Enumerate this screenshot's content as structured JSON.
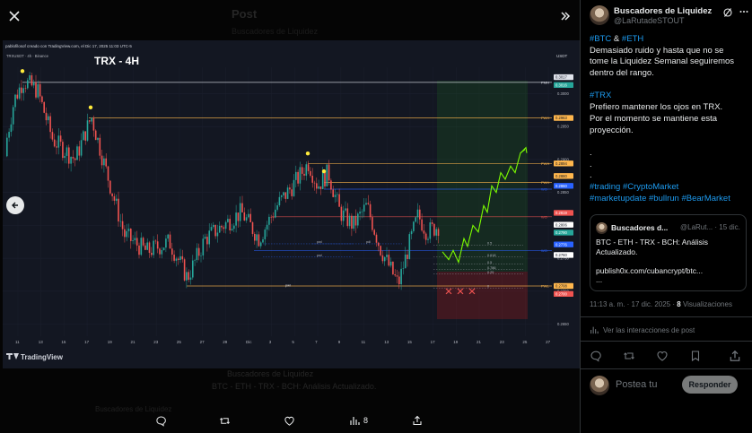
{
  "viewer": {
    "ghost_title": "Post",
    "ghost_author": "Buscadores de Liquidez",
    "ghost_reply_author": "Buscadores de Liquidez",
    "ghost_reply_text": "BTC - ETH - TRX - BCH: Análisis Actualizado.",
    "ghost_quote_author": "Buscadores de Liquidez"
  },
  "tradingview": {
    "header": "pablofilosof creado con TradingView.com, el Dic 17, 2025 11:03 UTC-5",
    "symbol": "TRXUSDT · 4h · Binance",
    "overlay_title": "TRX - 4H",
    "currency": "USDT",
    "logo_text": "TradingView",
    "x_ticks": [
      "11",
      "13",
      "15",
      "17",
      "19",
      "21",
      "23",
      "25",
      "27",
      "29",
      "Dic",
      "3",
      "5",
      "7",
      "9",
      "11",
      "13",
      "15",
      "17",
      "19",
      "21",
      "23",
      "25",
      "27"
    ],
    "y_ticks": [
      "0.3000",
      "0.2950",
      "0.2900",
      "0.2850",
      "0.2800",
      "0.2750",
      "0.2700",
      "0.2650"
    ],
    "levels": [
      {
        "label": "PMH",
        "price": "0.3017",
        "color": "#e0e3eb",
        "value": 0.3017
      },
      {
        "label": "PWH",
        "price": "0.2963",
        "color": "#ffb74d",
        "value": 0.2963
      },
      {
        "label": "PWH",
        "price": "0.2894",
        "color": "#ffb74d",
        "value": 0.2894
      },
      {
        "label": "PWH",
        "price": "0.2880",
        "color": "#ffb74d",
        "value": 0.2865
      },
      {
        "label": "WO",
        "price": "0.2860",
        "color": "#2962ff",
        "value": 0.2855
      },
      {
        "label": "WO",
        "price": "0.2819",
        "color": "#ef5350",
        "value": 0.2813
      },
      {
        "label": "WO",
        "price": "0.2776",
        "color": "#2962ff",
        "value": 0.2762
      },
      {
        "label": "PWL",
        "price": "0.2708",
        "color": "#ffb74d",
        "value": 0.2708
      }
    ],
    "axis_prices": [
      "0.3017",
      "0.3016",
      "0.2963",
      "0.2894",
      "0.2880",
      "0.2860",
      "0.2819",
      "0.2806",
      "0.2790",
      "0.2776",
      "0.2760",
      "0.2708",
      "0.2700"
    ],
    "annotations": [
      "pwl",
      "pdl",
      "pwl",
      "0.5",
      "0.618",
      "0.5",
      "0.786",
      "0.25",
      "0"
    ],
    "target_label": "PWH"
  },
  "actions": {
    "views_count": "8"
  },
  "post": {
    "author_name": "Buscadores de Liquidez",
    "author_handle": "@LaRutadeSTOUT",
    "text_lines": [
      {
        "parts": [
          {
            "t": "#BTC",
            "tag": true
          },
          {
            "t": " & ",
            "tag": false
          },
          {
            "t": "#ETH",
            "tag": true
          }
        ]
      },
      {
        "parts": [
          {
            "t": "Demasiado ruido y hasta que no se",
            "tag": false
          }
        ]
      },
      {
        "parts": [
          {
            "t": "tome la Liquidez Semanal seguiremos",
            "tag": false
          }
        ]
      },
      {
        "parts": [
          {
            "t": "dentro del rango.",
            "tag": false
          }
        ]
      },
      {
        "parts": [
          {
            "t": "",
            "tag": false
          }
        ]
      },
      {
        "parts": [
          {
            "t": "#TRX",
            "tag": true
          }
        ]
      },
      {
        "parts": [
          {
            "t": "Prefiero mantener los ojos en TRX.",
            "tag": false
          }
        ]
      },
      {
        "parts": [
          {
            "t": "Por el momento se mantiene esta",
            "tag": false
          }
        ]
      },
      {
        "parts": [
          {
            "t": "proyección.",
            "tag": false
          }
        ]
      },
      {
        "parts": [
          {
            "t": "",
            "tag": false
          }
        ]
      },
      {
        "parts": [
          {
            "t": ".",
            "tag": false
          }
        ]
      },
      {
        "parts": [
          {
            "t": ".",
            "tag": false
          }
        ]
      },
      {
        "parts": [
          {
            "t": ".",
            "tag": false
          }
        ]
      },
      {
        "parts": [
          {
            "t": "#trading",
            "tag": true
          },
          {
            "t": " ",
            "tag": false
          },
          {
            "t": "#CryptoMarket",
            "tag": true
          }
        ]
      },
      {
        "parts": [
          {
            "t": "#marketupdate",
            "tag": true
          },
          {
            "t": " ",
            "tag": false
          },
          {
            "t": "#bullrun",
            "tag": true
          },
          {
            "t": " ",
            "tag": false
          },
          {
            "t": "#BearMarket",
            "tag": true
          }
        ]
      }
    ],
    "quote": {
      "name": "Buscadores d...",
      "handle": "@LaRut... · 15 dic.",
      "text_lines": [
        "BTC - ETH - TRX - BCH: Análisis",
        "Actualizado.",
        "",
        "publish0x.com/cubancrypt/btc...",
        "..."
      ]
    },
    "time": "11:13 a. m. · 17 dic. 2025",
    "views": "8",
    "views_label": "Visualizaciones",
    "interactions_label": "Ver las interacciones de post",
    "reply_placeholder": "Postea tu",
    "reply_button": "Responder"
  },
  "colors": {
    "link": "#1d9bf0",
    "up": "#26a69a",
    "down": "#ef5350",
    "projection": "#7cfc00"
  }
}
